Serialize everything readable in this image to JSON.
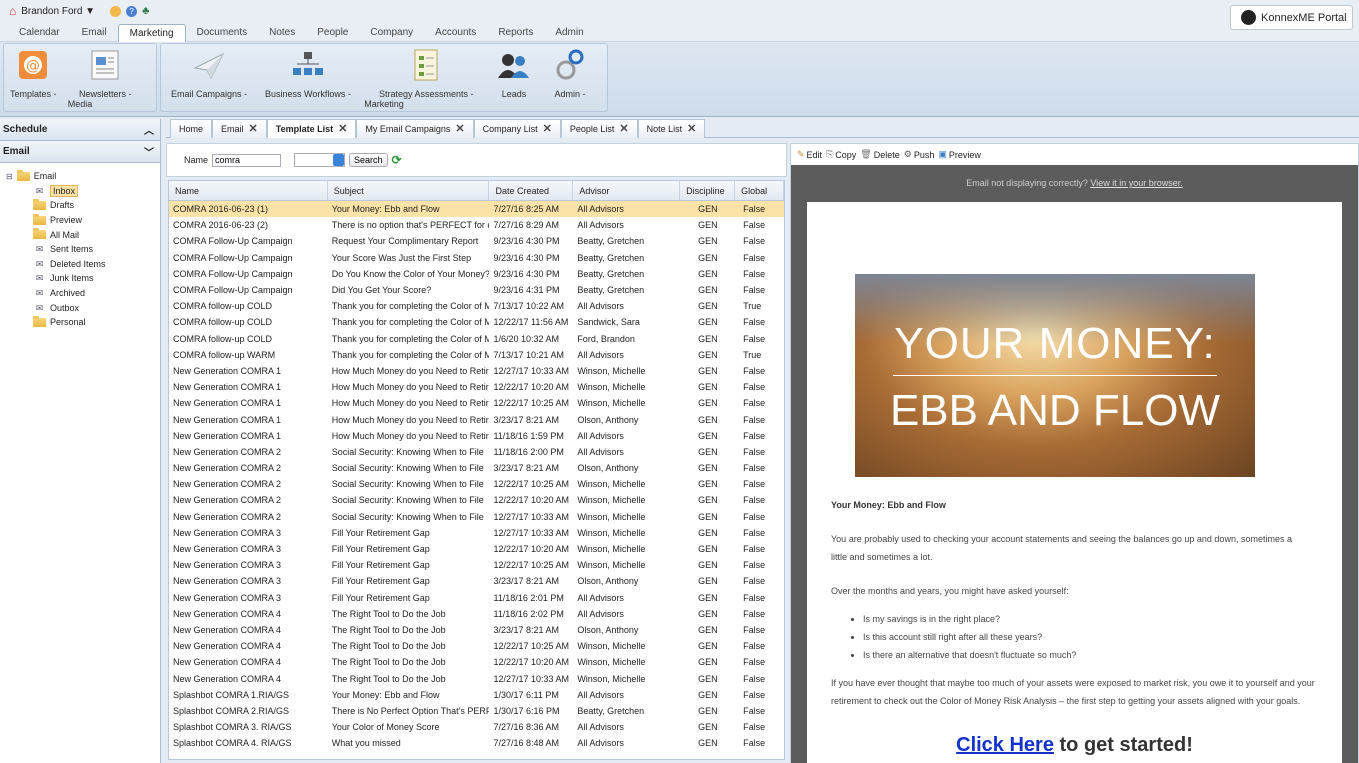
{
  "user": {
    "name": "Brandon Ford ▼"
  },
  "portal": {
    "label": "KonnexME Portal"
  },
  "nav_tabs": [
    "Calendar",
    "Email",
    "Marketing",
    "Documents",
    "Notes",
    "People",
    "Company",
    "Accounts",
    "Reports",
    "Admin"
  ],
  "nav_active": "Marketing",
  "ribbon": {
    "media": {
      "group": "Media",
      "templates": "Templates -",
      "newsletters": "Newsletters -"
    },
    "marketing": {
      "group": "Marketing",
      "campaigns": "Email Campaigns -",
      "workflows": "Business Workflows -",
      "assessments": "Strategy Assessments -",
      "leads": "Leads",
      "admin": "Admin -"
    }
  },
  "left": {
    "schedule": "Schedule",
    "email_section": "Email",
    "tree_root": "Email",
    "folders": [
      "Inbox",
      "Drafts",
      "Preview",
      "All Mail",
      "Sent Items",
      "Deleted Items",
      "Junk Items",
      "Archived",
      "Outbox",
      "Personal"
    ]
  },
  "content_tabs": [
    {
      "label": "Home",
      "closable": false
    },
    {
      "label": "Email",
      "closable": true
    },
    {
      "label": "Template List",
      "closable": true,
      "active": true
    },
    {
      "label": "My Email Campaigns",
      "closable": true
    },
    {
      "label": "Company List",
      "closable": true
    },
    {
      "label": "People List",
      "closable": true
    },
    {
      "label": "Note List",
      "closable": true
    }
  ],
  "search": {
    "name_label": "Name",
    "value": "comra",
    "button": "Search"
  },
  "grid": {
    "columns": [
      "Name",
      "Subject",
      "Date Created",
      "Advisor",
      "Discipline",
      "Global"
    ],
    "rows": [
      [
        "COMRA 2016-06-23 (1)",
        "Your Money: Ebb and Flow",
        "7/27/16 8:25 AM",
        "All Advisors",
        "GEN",
        "False"
      ],
      [
        "COMRA 2016-06-23 (2)",
        "There is no option that's PERFECT for every",
        "7/27/16 8:29 AM",
        "All Advisors",
        "GEN",
        "False"
      ],
      [
        "COMRA Follow-Up Campaign",
        "Request Your Complimentary Report",
        "9/23/16 4:30 PM",
        "Beatty, Gretchen",
        "GEN",
        "False"
      ],
      [
        "COMRA Follow-Up Campaign",
        "Your Score Was Just the First Step",
        "9/23/16 4:30 PM",
        "Beatty, Gretchen",
        "GEN",
        "False"
      ],
      [
        "COMRA Follow-Up Campaign",
        "Do You Know the Color of Your Money?",
        "9/23/16 4:30 PM",
        "Beatty, Gretchen",
        "GEN",
        "False"
      ],
      [
        "COMRA Follow-Up Campaign",
        "Did You Get Your Score?",
        "9/23/16 4:31 PM",
        "Beatty, Gretchen",
        "GEN",
        "False"
      ],
      [
        "COMRA follow-up COLD",
        "Thank you for completing the Color of Money",
        "7/13/17 10:22 AM",
        "All Advisors",
        "GEN",
        "True"
      ],
      [
        "COMRA follow-up COLD",
        "Thank you for completing the Color of Money",
        "12/22/17 11:56 AM",
        "Sandwick, Sara",
        "GEN",
        "False"
      ],
      [
        "COMRA follow-up COLD",
        "Thank you for completing the Color of Money",
        "1/6/20 10:32 AM",
        "Ford, Brandon",
        "GEN",
        "False"
      ],
      [
        "COMRA follow-up WARM",
        "Thank you for completing the Color of Money",
        "7/13/17 10:21 AM",
        "All Advisors",
        "GEN",
        "True"
      ],
      [
        "New Generation COMRA 1",
        "How Much Money do you Need to Retire",
        "12/27/17 10:33 AM",
        "Winson, Michelle",
        "GEN",
        "False"
      ],
      [
        "New Generation COMRA 1",
        "How Much Money do you Need to Retire",
        "12/22/17 10:20 AM",
        "Winson, Michelle",
        "GEN",
        "False"
      ],
      [
        "New Generation COMRA 1",
        "How Much Money do you Need to Retire",
        "12/22/17 10:25 AM",
        "Winson, Michelle",
        "GEN",
        "False"
      ],
      [
        "New Generation COMRA 1",
        "How Much Money do you Need to Retire",
        "3/23/17 8:21 AM",
        "Olson, Anthony",
        "GEN",
        "False"
      ],
      [
        "New Generation COMRA 1",
        "How Much Money do you Need to Retire",
        "11/18/16 1:59 PM",
        "All Advisors",
        "GEN",
        "False"
      ],
      [
        "New Generation COMRA 2",
        "Social Security: Knowing When to File",
        "11/18/16 2:00 PM",
        "All Advisors",
        "GEN",
        "False"
      ],
      [
        "New Generation COMRA 2",
        "Social Security: Knowing When to File",
        "3/23/17 8:21 AM",
        "Olson, Anthony",
        "GEN",
        "False"
      ],
      [
        "New Generation COMRA 2",
        "Social Security: Knowing When to File",
        "12/22/17 10:25 AM",
        "Winson, Michelle",
        "GEN",
        "False"
      ],
      [
        "New Generation COMRA 2",
        "Social Security: Knowing When to File",
        "12/22/17 10:20 AM",
        "Winson, Michelle",
        "GEN",
        "False"
      ],
      [
        "New Generation COMRA 2",
        "Social Security: Knowing When to File",
        "12/27/17 10:33 AM",
        "Winson, Michelle",
        "GEN",
        "False"
      ],
      [
        "New Generation COMRA 3",
        "Fill Your Retirement Gap",
        "12/27/17 10:33 AM",
        "Winson, Michelle",
        "GEN",
        "False"
      ],
      [
        "New Generation COMRA 3",
        "Fill Your Retirement Gap",
        "12/22/17 10:20 AM",
        "Winson, Michelle",
        "GEN",
        "False"
      ],
      [
        "New Generation COMRA 3",
        "Fill Your Retirement Gap",
        "12/22/17 10:25 AM",
        "Winson, Michelle",
        "GEN",
        "False"
      ],
      [
        "New Generation COMRA 3",
        "Fill Your Retirement Gap",
        "3/23/17 8:21 AM",
        "Olson, Anthony",
        "GEN",
        "False"
      ],
      [
        "New Generation COMRA 3",
        "Fill Your Retirement Gap",
        "11/18/16 2:01 PM",
        "All Advisors",
        "GEN",
        "False"
      ],
      [
        "New Generation COMRA 4",
        "The Right Tool to Do the Job",
        "11/18/16 2:02 PM",
        "All Advisors",
        "GEN",
        "False"
      ],
      [
        "New Generation COMRA 4",
        "The Right Tool to Do the Job",
        "3/23/17 8:21 AM",
        "Olson, Anthony",
        "GEN",
        "False"
      ],
      [
        "New Generation COMRA 4",
        "The Right Tool to Do the Job",
        "12/22/17 10:25 AM",
        "Winson, Michelle",
        "GEN",
        "False"
      ],
      [
        "New Generation COMRA 4",
        "The Right Tool to Do the Job",
        "12/22/17 10:20 AM",
        "Winson, Michelle",
        "GEN",
        "False"
      ],
      [
        "New Generation COMRA 4",
        "The Right Tool to Do the Job",
        "12/27/17 10:33 AM",
        "Winson, Michelle",
        "GEN",
        "False"
      ],
      [
        "Splashbot COMRA 1.RIA/GS",
        "Your Money: Ebb and Flow",
        "1/30/17 6:11 PM",
        "All Advisors",
        "GEN",
        "False"
      ],
      [
        "Splashbot COMRA 2.RIA/GS",
        "There is No Perfect Option That's PERFECT",
        "1/30/17 6:16 PM",
        "Beatty, Gretchen",
        "GEN",
        "False"
      ],
      [
        "Splashbot COMRA 3. RIA/GS",
        "Your Color of Money Score",
        "7/27/16 8:36 AM",
        "All Advisors",
        "GEN",
        "False"
      ],
      [
        "Splashbot COMRA 4. RIA/GS",
        "What you missed",
        "7/27/16 8:48 AM",
        "All Advisors",
        "GEN",
        "False"
      ]
    ]
  },
  "preview_toolbar": {
    "edit": "Edit",
    "copy": "Copy",
    "delete": "Delete",
    "push": "Push",
    "preview": "Preview"
  },
  "email_preview": {
    "notice": "Email not displaying correctly?",
    "notice_link": "View it in your browser.",
    "hero_line1": "YOUR MONEY:",
    "hero_line2": "EBB AND FLOW",
    "heading": "Your Money: Ebb and Flow",
    "p1": "You are probably used to checking your account statements and seeing the balances go up and down, sometimes a little and sometimes a lot.",
    "p2": "Over the months and years, you might have asked yourself:",
    "bullets": [
      "Is my savings is in the right place?",
      "Is this account still right after all these years?",
      "Is there an alternative that doesn't fluctuate so much?"
    ],
    "p3": "If you have ever thought that maybe too much of your assets were exposed to market risk, you owe it to yourself and your retirement to check out the Color of Money Risk Analysis – the first step to getting your assets aligned with your goals.",
    "cta_link": "Click Here",
    "cta_rest": " to get started!"
  }
}
